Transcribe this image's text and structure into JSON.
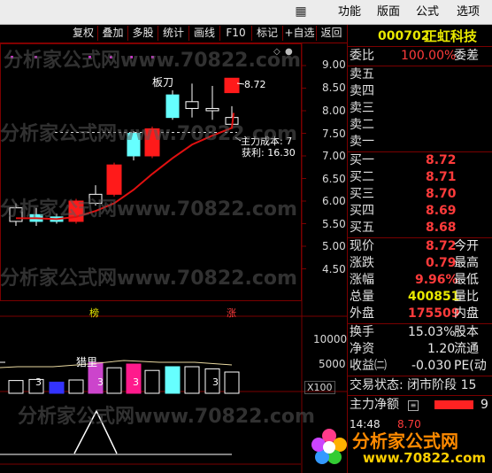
{
  "menubar": {
    "items": [
      "功能",
      "版面",
      "公式",
      "选项"
    ]
  },
  "toolbar": {
    "buttons": [
      "复权",
      "叠加",
      "多股",
      "统计",
      "画线",
      "F10",
      "标记",
      "+自选",
      "返回"
    ]
  },
  "chart": {
    "price_ticks": [
      "9.00",
      "8.50",
      "8.00",
      "7.50",
      "7.00",
      "6.50",
      "6.00",
      "5.50",
      "5.00",
      "4.50"
    ],
    "volume_ticks": [
      "10000",
      "5000"
    ],
    "volume_unit": "X100",
    "annotations": {
      "bandao": "板刀",
      "last_price": "8.72",
      "main_cost": "主力成本: 7",
      "profit": "获利: 16.30",
      "bang": "榜",
      "zhang": "涨",
      "xianli": "猎里"
    },
    "watermark": "分析家公式网www.70822.com",
    "candles": [
      {
        "o": 5.85,
        "c": 5.55,
        "h": 5.95,
        "l": 5.45,
        "up": false
      },
      {
        "o": 5.7,
        "c": 5.55,
        "h": 5.85,
        "l": 5.45,
        "up": false
      },
      {
        "o": 5.55,
        "c": 5.65,
        "h": 5.72,
        "l": 5.5,
        "up": false
      },
      {
        "o": 5.55,
        "c": 6.0,
        "h": 6.05,
        "l": 5.5,
        "up": true
      },
      {
        "o": 5.95,
        "c": 6.15,
        "h": 6.35,
        "l": 5.9,
        "up": false
      },
      {
        "o": 6.15,
        "c": 6.8,
        "h": 6.85,
        "l": 6.1,
        "up": true
      },
      {
        "o": 7.0,
        "c": 7.5,
        "h": 7.55,
        "l": 6.9,
        "up": false
      },
      {
        "o": 7.0,
        "c": 7.6,
        "h": 7.65,
        "l": 6.95,
        "up": true
      },
      {
        "o": 7.85,
        "c": 8.35,
        "h": 8.45,
        "l": 7.8,
        "up": false
      },
      {
        "o": 8.2,
        "c": 8.05,
        "h": 8.6,
        "l": 7.85,
        "up": false
      },
      {
        "o": 8.05,
        "c": 8.0,
        "h": 8.55,
        "l": 7.8,
        "up": false
      },
      {
        "o": 7.85,
        "c": 7.7,
        "h": 8.1,
        "l": 7.6,
        "up": false
      },
      {
        "o": 8.4,
        "c": 8.72,
        "h": 8.72,
        "l": 8.4,
        "up": true
      }
    ],
    "ma_line": [
      5.62,
      5.62,
      5.6,
      5.65,
      5.78,
      5.95,
      6.25,
      6.6,
      6.95,
      7.25,
      7.45,
      7.62,
      7.95
    ],
    "cost_level": 7.52,
    "volumes": [
      {
        "v": 2400,
        "color": "#ffffff",
        "fill": false
      },
      {
        "v": 2600,
        "color": "#ffffff",
        "fill": false
      },
      {
        "v": 2100,
        "color": "#3333ff",
        "fill": true
      },
      {
        "v": 2500,
        "color": "#ffffff",
        "fill": false
      },
      {
        "v": 5800,
        "color": "#cc44cc",
        "fill": true
      },
      {
        "v": 4800,
        "color": "#ffffff",
        "fill": false
      },
      {
        "v": 5500,
        "color": "#ff1a8c",
        "fill": true
      },
      {
        "v": 4300,
        "color": "#ffffff",
        "fill": false
      },
      {
        "v": 5000,
        "color": "#66ffff",
        "fill": true
      },
      {
        "v": 5000,
        "color": "#ffffff",
        "fill": false
      },
      {
        "v": 4600,
        "color": "#ffffff",
        "fill": false
      },
      {
        "v": 4000,
        "color": "#ffffff",
        "fill": false
      }
    ]
  },
  "quote": {
    "code": "000702",
    "name": "正虹科技",
    "weibi_label": "委比",
    "weibi_value": "100.00%",
    "weicha_label": "委差",
    "sell": [
      {
        "label": "卖五",
        "price": ""
      },
      {
        "label": "卖四",
        "price": ""
      },
      {
        "label": "卖三",
        "price": ""
      },
      {
        "label": "卖二",
        "price": ""
      },
      {
        "label": "卖一",
        "price": ""
      }
    ],
    "buy": [
      {
        "label": "买一",
        "price": "8.72"
      },
      {
        "label": "买二",
        "price": "8.71"
      },
      {
        "label": "买三",
        "price": "8.70"
      },
      {
        "label": "买四",
        "price": "8.69"
      },
      {
        "label": "买五",
        "price": "8.68"
      }
    ],
    "stats": [
      {
        "label": "现价",
        "value": "8.72",
        "cls": "red",
        "label2": "今开"
      },
      {
        "label": "涨跌",
        "value": "0.79",
        "cls": "red",
        "label2": "最高"
      },
      {
        "label": "涨幅",
        "value": "9.96%",
        "cls": "red",
        "label2": "最低"
      },
      {
        "label": "总量",
        "value": "400851",
        "cls": "yellow",
        "label2": "量比"
      },
      {
        "label": "外盘",
        "value": "175509",
        "cls": "red",
        "label2": "内盘"
      }
    ],
    "stats2": [
      {
        "label": "换手",
        "value": "15.03%",
        "cls": "white",
        "label2": "股本"
      },
      {
        "label": "净资",
        "value": "1.20",
        "cls": "white",
        "label2": "流通"
      },
      {
        "label": "收益㈡",
        "value": "-0.030",
        "cls": "white",
        "label2": "PE(动"
      }
    ],
    "trade_status": "交易状态: 闭市阶段 15",
    "main_net_label": "主力净额",
    "main_net_value": "9",
    "tick_time": "14:48",
    "tick_price": "8.70"
  },
  "logo": {
    "text": "分析家公式网",
    "url": "www.70822.com"
  }
}
